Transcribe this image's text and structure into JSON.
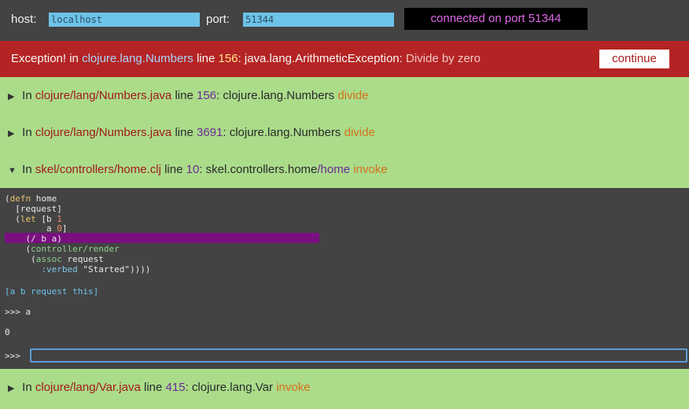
{
  "connection": {
    "host_label": "host:",
    "host_value": "localhost",
    "port_label": "port:",
    "port_value": "51344",
    "status": "connected on port 51344"
  },
  "exception": {
    "prefix": "Exception! in",
    "cls": "clojure.lang.Numbers",
    "line_word": "line",
    "line": "156",
    "type": "java.lang.ArithmeticException:",
    "message": "Divide by zero",
    "continue_label": "continue"
  },
  "frames": [
    {
      "in": "In",
      "file": "clojure/lang/Numbers.java",
      "line_word": "line",
      "line": "156",
      "ns": "clojure.lang.Numbers",
      "name": "",
      "fn": "divide"
    },
    {
      "in": "In",
      "file": "clojure/lang/Numbers.java",
      "line_word": "line",
      "line": "3691",
      "ns": "clojure.lang.Numbers",
      "name": "",
      "fn": "divide"
    },
    {
      "in": "In",
      "file": "skel/controllers/home.clj",
      "line_word": "line",
      "line": "10",
      "ns": "skel.controllers.home",
      "name": "/home",
      "fn": "invoke"
    },
    {
      "in": "In",
      "file": "clojure/lang/Var.java",
      "line_word": "line",
      "line": "415",
      "ns": "clojure.lang.Var",
      "name": "",
      "fn": "invoke"
    }
  ],
  "code": {
    "l1a": "(",
    "l1b": "defn",
    "l1c": " home",
    "l2": "  [request]",
    "l3a": "  (",
    "l3b": "let",
    "l3c": " [b ",
    "l3d": "1",
    "l4a": "        a ",
    "l4b": "0",
    "l4c": "]",
    "l5": "    (/ b a)",
    "l6a": "    (",
    "l6b": "controller/render",
    "l7a": "     (",
    "l7b": "assoc",
    "l7c": " request",
    "l8a": "       ",
    "l8b": ":verbed",
    "l8c": " \"Started\"))))"
  },
  "locals": "[a b request this]",
  "repl": {
    "prompt1": ">>> a",
    "result1": "0",
    "prompt2": ">>>",
    "input_value": ""
  },
  "colors": {
    "exception_bg": "#b52424",
    "frame_bg": "#abdc8a",
    "highlight": "#7a0f80",
    "status_text": "#e066e8"
  },
  "icons": {
    "collapsed": "triangle-right-icon",
    "expanded": "triangle-down-icon"
  }
}
